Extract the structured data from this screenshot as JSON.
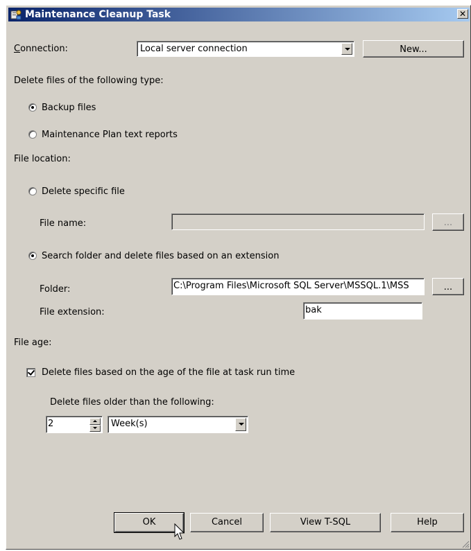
{
  "window": {
    "title": "Maintenance Cleanup Task",
    "close_glyph": "✕"
  },
  "connection": {
    "label": "Connection:",
    "value": "Local server connection",
    "new_button": "New..."
  },
  "delete_type": {
    "heading": "Delete files of the following type:",
    "options": [
      {
        "label": "Backup files",
        "checked": true
      },
      {
        "label": "Maintenance Plan text reports",
        "checked": false
      }
    ]
  },
  "file_location": {
    "heading": "File location:",
    "specific_file_option": "Delete specific file",
    "file_name_label": "File name:",
    "file_name_value": "",
    "browse_label": "...",
    "search_folder_option": "Search folder and delete files based on an extension",
    "folder_label": "Folder:",
    "folder_value": "C:\\Program Files\\Microsoft SQL Server\\MSSQL.1\\MSS",
    "extension_label": "File extension:",
    "extension_value": "bak"
  },
  "file_age": {
    "heading": "File age:",
    "checkbox_label": "Delete files based on the age of the file at task run time",
    "checked": true,
    "older_than_label": "Delete files older than the following:",
    "amount": "2",
    "unit": "Week(s)"
  },
  "buttons": {
    "ok": "OK",
    "cancel": "Cancel",
    "view_tsql": "View T-SQL",
    "help": "Help"
  },
  "icons": [
    "app-icon",
    "close-icon",
    "dropdown-arrow-icon",
    "spin-up-icon",
    "spin-down-icon",
    "mouse-cursor-icon",
    "resize-grip-icon"
  ]
}
